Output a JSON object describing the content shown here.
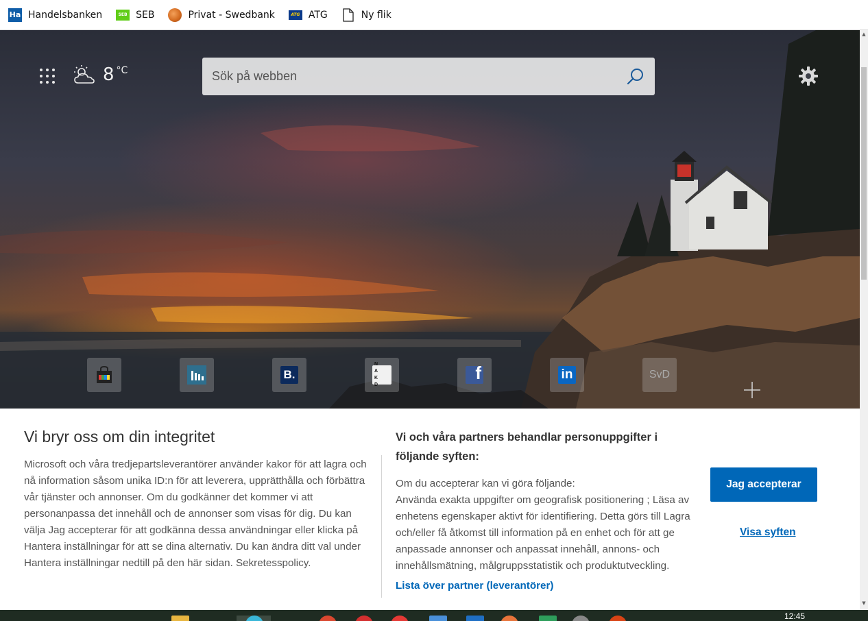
{
  "favorites": [
    {
      "label": "Handelsbanken",
      "icon": "handelsbanken-icon",
      "icon_text": "Ha"
    },
    {
      "label": "SEB",
      "icon": "seb-icon",
      "icon_text": "SEB"
    },
    {
      "label": "Privat - Swedbank",
      "icon": "swedbank-icon"
    },
    {
      "label": "ATG",
      "icon": "atg-icon",
      "icon_text": "ATG"
    },
    {
      "label": "Ny flik",
      "icon": "document-icon"
    }
  ],
  "weather": {
    "temp": "8",
    "unit": "°C",
    "icon": "partly-cloudy-icon"
  },
  "search": {
    "placeholder": "Sök på webben"
  },
  "tiles": [
    {
      "name": "shopping-tile",
      "icon": "shopping-bag-icon"
    },
    {
      "name": "stats-tile",
      "icon": "chart-icon"
    },
    {
      "name": "booking-tile",
      "icon": "booking-icon",
      "text": "B."
    },
    {
      "name": "nakd-tile",
      "icon": "nakd-icon",
      "text": "NAKD"
    },
    {
      "name": "facebook-tile",
      "icon": "facebook-icon",
      "text": "f"
    },
    {
      "name": "linkedin-tile",
      "icon": "linkedin-icon",
      "text": "in"
    },
    {
      "name": "svd-tile",
      "icon": "svd-icon",
      "text": "SvD"
    }
  ],
  "consent": {
    "title": "Vi bryr oss om din integritet",
    "body": "Microsoft och våra tredjepartsleverantörer använder kakor för att lagra och nå information såsom unika ID:n för att leverera, upprätthålla och förbättra vår tjänster och annonser. Om du godkänner det kommer vi att personanpassa det innehåll och de annonser som visas för dig. Du kan välja Jag accepterar för att godkänna dessa användningar eller klicka på Hantera inställningar för att se dina alternativ. Du kan ändra ditt val under Hantera inställningar nedtill på den här sidan. Sekretesspolicy.",
    "subtitle": "Vi och våra partners behandlar personuppgifter i följande syften:",
    "purposes_intro": "Om du accepterar kan vi göra följande:",
    "purposes_text": "Använda exakta uppgifter om geografisk positionering ; Läsa av enhetens egenskaper aktivt för identifiering. Detta görs till Lagra och/eller få åtkomst till information på en enhet och för att ge anpassade annonser och anpassat innehåll, annons- och innehållsmätning, målgruppsstatistik och produktutveckling.",
    "partners_link": "Lista över partner (leverantörer)",
    "accept_label": "Jag accepterar",
    "show_purposes_label": "Visa syften"
  },
  "taskbar": {
    "clock": "12:45"
  },
  "colors": {
    "accent": "#0067b8",
    "link": "#0067b8"
  }
}
